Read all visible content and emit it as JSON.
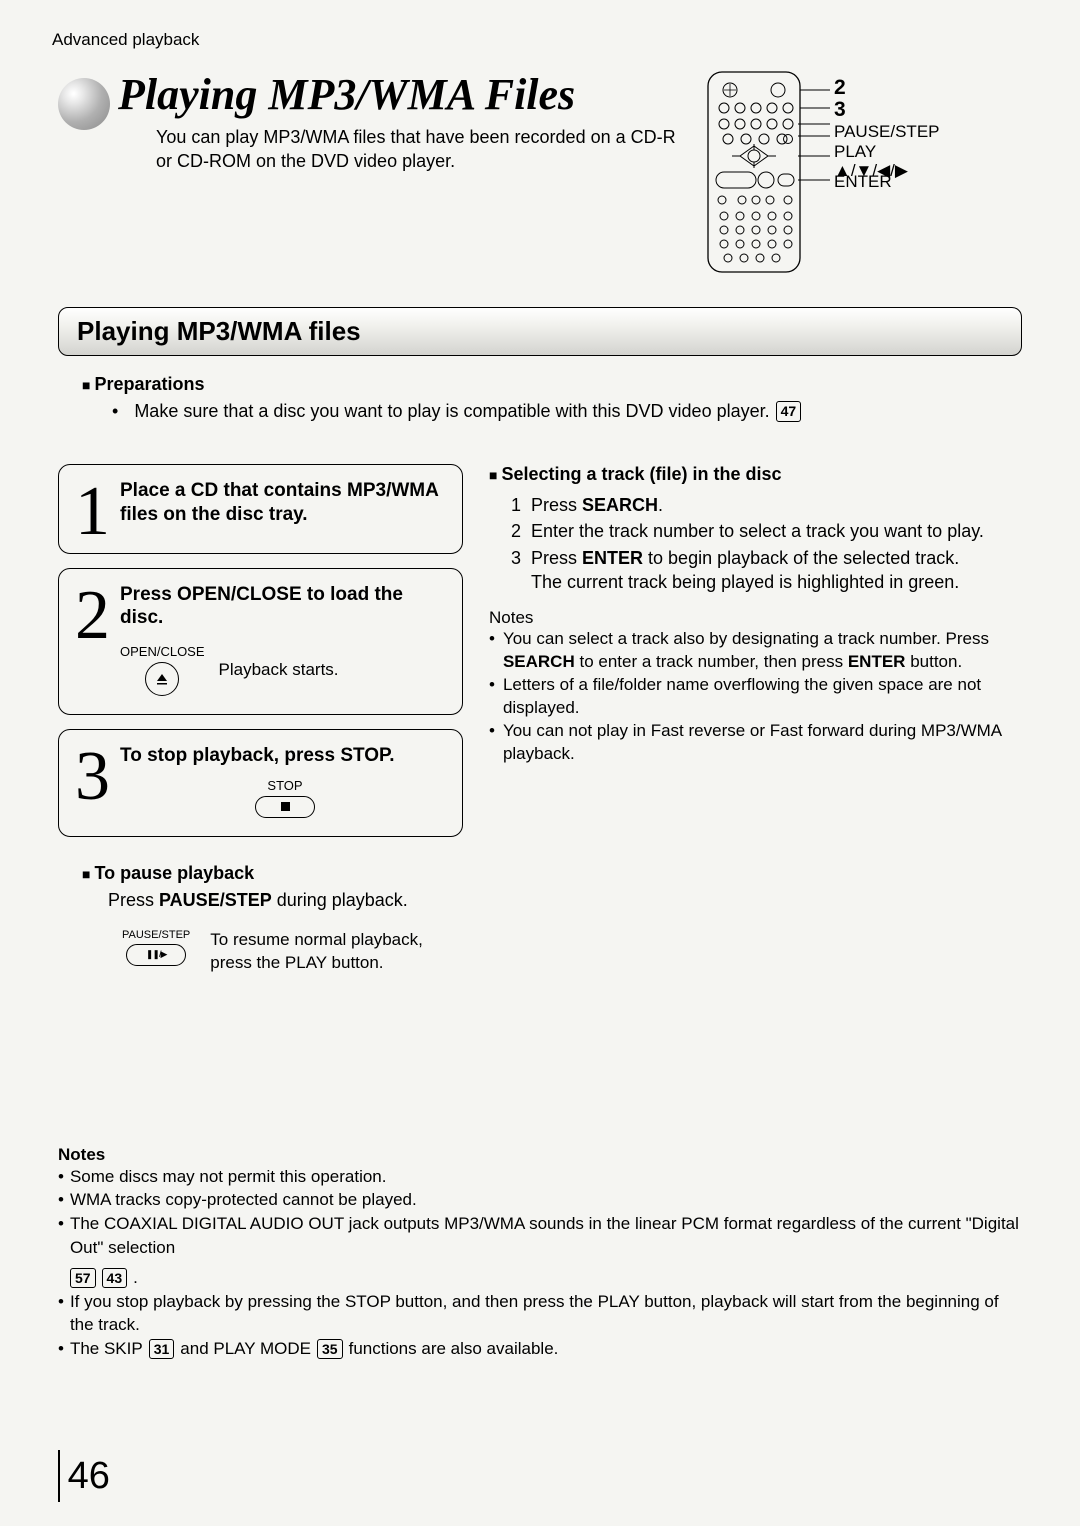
{
  "breadcrumb": "Advanced playback",
  "title": "Playing MP3/WMA Files",
  "subtitle": "You can play MP3/WMA files that have been recorded on a CD-R or CD-ROM on the DVD video player.",
  "remote_callouts": {
    "c2_num": "2",
    "c3_num": "3",
    "pause_step": "PAUSE/STEP",
    "play": "PLAY",
    "arrows": "▲/▼/◀/▶",
    "enter": "ENTER"
  },
  "section_bar": "Playing MP3/WMA files",
  "preparations_head": "Preparations",
  "preparations_body_pre": "Make sure that a disc you want to play is compatible with this DVD video player.",
  "preparations_pageref": "47",
  "steps": [
    {
      "num": "1",
      "title": "Place a CD that contains MP3/WMA files on the disc tray."
    },
    {
      "num": "2",
      "title": "Press OPEN/CLOSE to load the disc.",
      "btn_label": "OPEN/CLOSE",
      "btn_note": "Playback starts."
    },
    {
      "num": "3",
      "title": "To stop playback, press STOP.",
      "btn_label": "STOP"
    }
  ],
  "selecting_head": "Selecting a track (file) in the disc",
  "selecting_steps": [
    {
      "n": "1",
      "text_pre": "Press ",
      "bold": "SEARCH",
      "text_post": "."
    },
    {
      "n": "2",
      "text": "Enter the track number to select a track you want to play."
    },
    {
      "n": "3",
      "text_pre": "Press ",
      "bold": "ENTER",
      "text_post": " to begin playback of the selected track.",
      "extra": "The current track being played is highlighted in green."
    }
  ],
  "notes_head": "Notes",
  "selecting_notes": [
    {
      "pre": "You can select a track also by designating a track number. Press ",
      "b1": "SEARCH",
      "mid": " to enter a track number, then press ",
      "b2": "ENTER",
      "post": " button."
    },
    {
      "text": "Letters of a file/folder name overflowing the given space are not displayed."
    },
    {
      "text": "You can not play in Fast reverse or Fast forward during MP3/WMA playback."
    }
  ],
  "pause_head": "To pause playback",
  "pause_body_pre": "Press ",
  "pause_body_bold": "PAUSE/STEP",
  "pause_body_post": " during playback.",
  "pause_btn_label": "PAUSE/STEP",
  "pause_btn_glyph": "❚❚/▶",
  "pause_resume": "To resume normal playback, press the PLAY button.",
  "bottom_notes_head": "Notes",
  "bottom_notes": [
    {
      "text": "Some discs may not permit this operation."
    },
    {
      "text": "WMA tracks copy-protected cannot be played."
    },
    {
      "pre": "The COAXIAL DIGITAL AUDIO OUT jack outputs MP3/WMA sounds in the linear PCM format regardless of the current \"Digital Out\" selection ",
      "refs": [
        "57",
        "43"
      ],
      "post": " ."
    },
    {
      "text": "If you stop playback by pressing the STOP button, and then press the PLAY button, playback will start from the beginning of the track."
    },
    {
      "pre": "The SKIP ",
      "refs": [
        "31"
      ],
      "mid": " and PLAY MODE ",
      "refs2": [
        "35"
      ],
      "post": " functions are also available."
    }
  ],
  "page_number": "46"
}
